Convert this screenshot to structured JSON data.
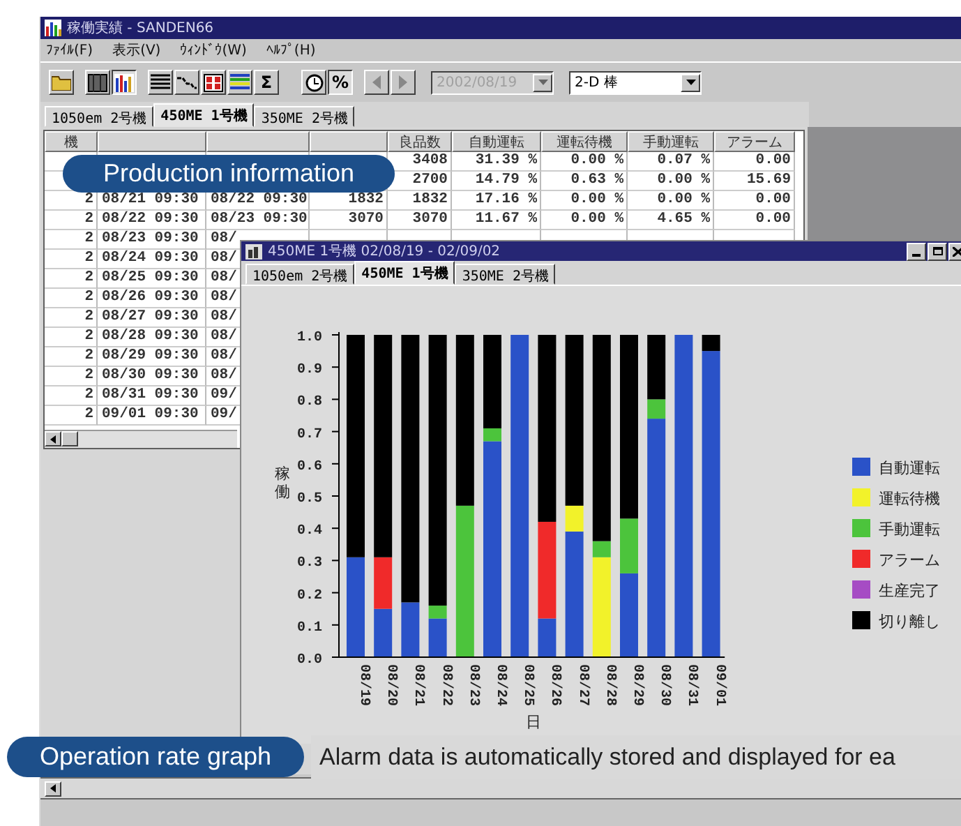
{
  "window": {
    "title": "稼働実績 - SANDEN66"
  },
  "menu": [
    "ﾌｧｲﾙ(F)",
    "表示(V)",
    "ｳｨﾝﾄﾞｳ(W)",
    "ﾍﾙﾌﾟ(H)"
  ],
  "toolbar": {
    "view_buttons": [
      {
        "selected": false
      },
      {
        "selected": true
      }
    ],
    "sum_button": {
      "label": "Σ",
      "selected": false
    },
    "percent_button": {
      "label": "%",
      "selected": true
    },
    "nav": {
      "disabled": true
    },
    "date_field": {
      "value": "2002/08/19",
      "disabled": true
    },
    "chart_type": {
      "value": "2-D 棒"
    }
  },
  "tabs": [
    {
      "label": "1050em 2号機",
      "selected": false
    },
    {
      "label": "450ME 1号機",
      "selected": true
    },
    {
      "label": "350ME 2号機",
      "selected": false
    }
  ],
  "table": {
    "columns": [
      {
        "label": "機"
      },
      {},
      {},
      {},
      {
        "label": "良品数"
      },
      {
        "label": "自動運転"
      },
      {
        "label": "運転待機"
      },
      {
        "label": "手動運転"
      },
      {
        "label": "アラーム"
      }
    ],
    "rows": [
      {
        "column_5": "3408",
        "column_6": "31.39 %",
        "column_7": "0.00 %",
        "column_8": "0.07 %",
        "column_9": "0.00"
      },
      {
        "column_5": "2700",
        "column_6": "14.79 %",
        "column_7": "0.63 %",
        "column_8": "0.00 %",
        "column_9": "15.69"
      },
      {
        "column_1": "2",
        "column_2": "08/21 09:30",
        "column_3": "08/22 09:30",
        "column_4": "1832",
        "column_5": "1832",
        "column_6": "17.16 %",
        "column_7": "0.00 %",
        "column_8": "0.00 %",
        "column_9": "0.00"
      },
      {
        "column_1": "2",
        "column_2": "08/22 09:30",
        "column_3": "08/23 09:30",
        "column_4": "3070",
        "column_5": "3070",
        "column_6": "11.67 %",
        "column_7": "0.00 %",
        "column_8": "4.65 %",
        "column_9": "0.00"
      },
      {
        "column_1": "2",
        "column_2": "08/23 09:30",
        "column_3": "08/"
      },
      {
        "column_1": "2",
        "column_2": "08/24 09:30",
        "column_3": "08/"
      },
      {
        "column_1": "2",
        "column_2": "08/25 09:30",
        "column_3": "08/"
      },
      {
        "column_1": "2",
        "column_2": "08/26 09:30",
        "column_3": "08/"
      },
      {
        "column_1": "2",
        "column_2": "08/27 09:30",
        "column_3": "08/"
      },
      {
        "column_1": "2",
        "column_2": "08/28 09:30",
        "column_3": "08/"
      },
      {
        "column_1": "2",
        "column_2": "08/29 09:30",
        "column_3": "08/"
      },
      {
        "column_1": "2",
        "column_2": "08/30 09:30",
        "column_3": "08/"
      },
      {
        "column_1": "2",
        "column_2": "08/31 09:30",
        "column_3": "09/"
      },
      {
        "column_1": "2",
        "column_2": "09/01 09:30",
        "column_3": "09/"
      }
    ]
  },
  "graph_window": {
    "title": "450ME 1号機 02/08/19 - 02/09/02",
    "tabs": [
      {
        "label": "1050em 2号機",
        "selected": false
      },
      {
        "label": "450ME 1号機",
        "selected": true
      },
      {
        "label": "350ME 2号機",
        "selected": false
      }
    ],
    "chart_data": {
      "type": "bar",
      "stacked": true,
      "legend": "right",
      "xlabel": "日",
      "ylabel": "稼働",
      "categories": [
        "08/19",
        "08/20",
        "08/21",
        "08/22",
        "08/23",
        "08/24",
        "08/25",
        "08/26",
        "08/27",
        "08/28",
        "08/29",
        "08/30",
        "08/31",
        "09/01"
      ],
      "ylim": [
        0,
        1
      ],
      "yticks": [
        {
          "value": 0,
          "label": "0.0"
        },
        {
          "value": 0.1,
          "label": "0.1"
        },
        {
          "value": 0.2,
          "label": "0.2"
        },
        {
          "value": 0.3,
          "label": "0.3"
        },
        {
          "value": 0.4,
          "label": "0.4"
        },
        {
          "value": 0.5,
          "label": "0.5"
        },
        {
          "value": 0.6,
          "label": "0.6"
        },
        {
          "value": 0.7,
          "label": "0.7"
        },
        {
          "value": 0.8,
          "label": "0.8"
        },
        {
          "value": 0.9,
          "label": "0.9"
        },
        {
          "value": 1,
          "label": "1.0"
        }
      ],
      "series": [
        {
          "name": "自動運転",
          "color": "#2a52c8",
          "values": [
            0.31,
            0.15,
            0.17,
            0.12,
            0,
            0.67,
            1,
            0.12,
            0.39,
            0,
            0.26,
            0.74,
            1,
            0.95
          ]
        },
        {
          "name": "運転待機",
          "color": "#f2f22a",
          "values": [
            0,
            0,
            0,
            0,
            0,
            0,
            0,
            0,
            0.08,
            0.31,
            0,
            0,
            0,
            0
          ]
        },
        {
          "name": "手動運転",
          "color": "#4cc43c",
          "values": [
            0,
            0,
            0,
            0.04,
            0.47,
            0.04,
            0,
            0,
            0,
            0.05,
            0.17,
            0.06,
            0,
            0
          ]
        },
        {
          "name": "アラーム",
          "color": "#f02a2a",
          "values": [
            0,
            0.16,
            0,
            0,
            0,
            0,
            0,
            0.3,
            0,
            0,
            0,
            0,
            0,
            0
          ]
        },
        {
          "name": "生産完了",
          "color": "#a64cc4",
          "values": [
            0,
            0,
            0,
            0,
            0,
            0,
            0,
            0,
            0,
            0,
            0,
            0,
            0,
            0
          ]
        },
        {
          "name": "切り離し",
          "color": "#000000",
          "values": [
            0.69,
            0.69,
            0.83,
            0.84,
            0.53,
            0.29,
            0,
            0.58,
            0.53,
            0.64,
            0.57,
            0.2,
            0,
            0.05
          ]
        }
      ]
    }
  },
  "captions": [
    {
      "label": "Production information"
    },
    {
      "label": "Operation rate graph",
      "text": "Alarm data is automatically stored and displayed for ea"
    }
  ]
}
